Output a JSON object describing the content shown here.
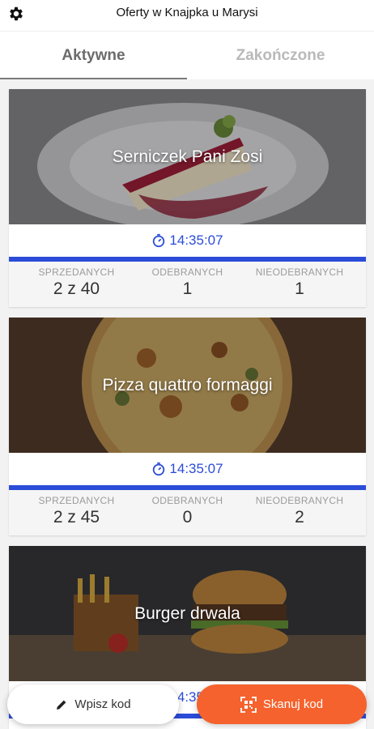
{
  "header": {
    "title": "Oferty w Knajpka u Marysi",
    "settings_icon": "gear-icon"
  },
  "tabs": [
    {
      "label": "Aktywne",
      "active": true
    },
    {
      "label": "Zakończone",
      "active": false
    }
  ],
  "offers": [
    {
      "name": "Serniczek Pani Zosi",
      "timer": "14:35:07",
      "stats": [
        {
          "label": "SPRZEDANYCH",
          "value": "2 z 40"
        },
        {
          "label": "ODEBRANYCH",
          "value": "1"
        },
        {
          "label": "NIEODEBRANYCH",
          "value": "1"
        }
      ]
    },
    {
      "name": "Pizza quattro formaggi",
      "timer": "14:35:07",
      "stats": [
        {
          "label": "SPRZEDANYCH",
          "value": "2 z 45"
        },
        {
          "label": "ODEBRANYCH",
          "value": "0"
        },
        {
          "label": "NIEODEBRANYCH",
          "value": "2"
        }
      ]
    },
    {
      "name": "Burger drwala",
      "timer": "14:35:07"
    }
  ],
  "actions": {
    "enter_code": {
      "label": "Wpisz kod",
      "icon": "pencil-icon"
    },
    "scan_code": {
      "label": "Skanuj kod",
      "icon": "qr-scan-icon"
    }
  },
  "colors": {
    "accent": "#2b4cd8",
    "scan_button": "#f5622d"
  }
}
